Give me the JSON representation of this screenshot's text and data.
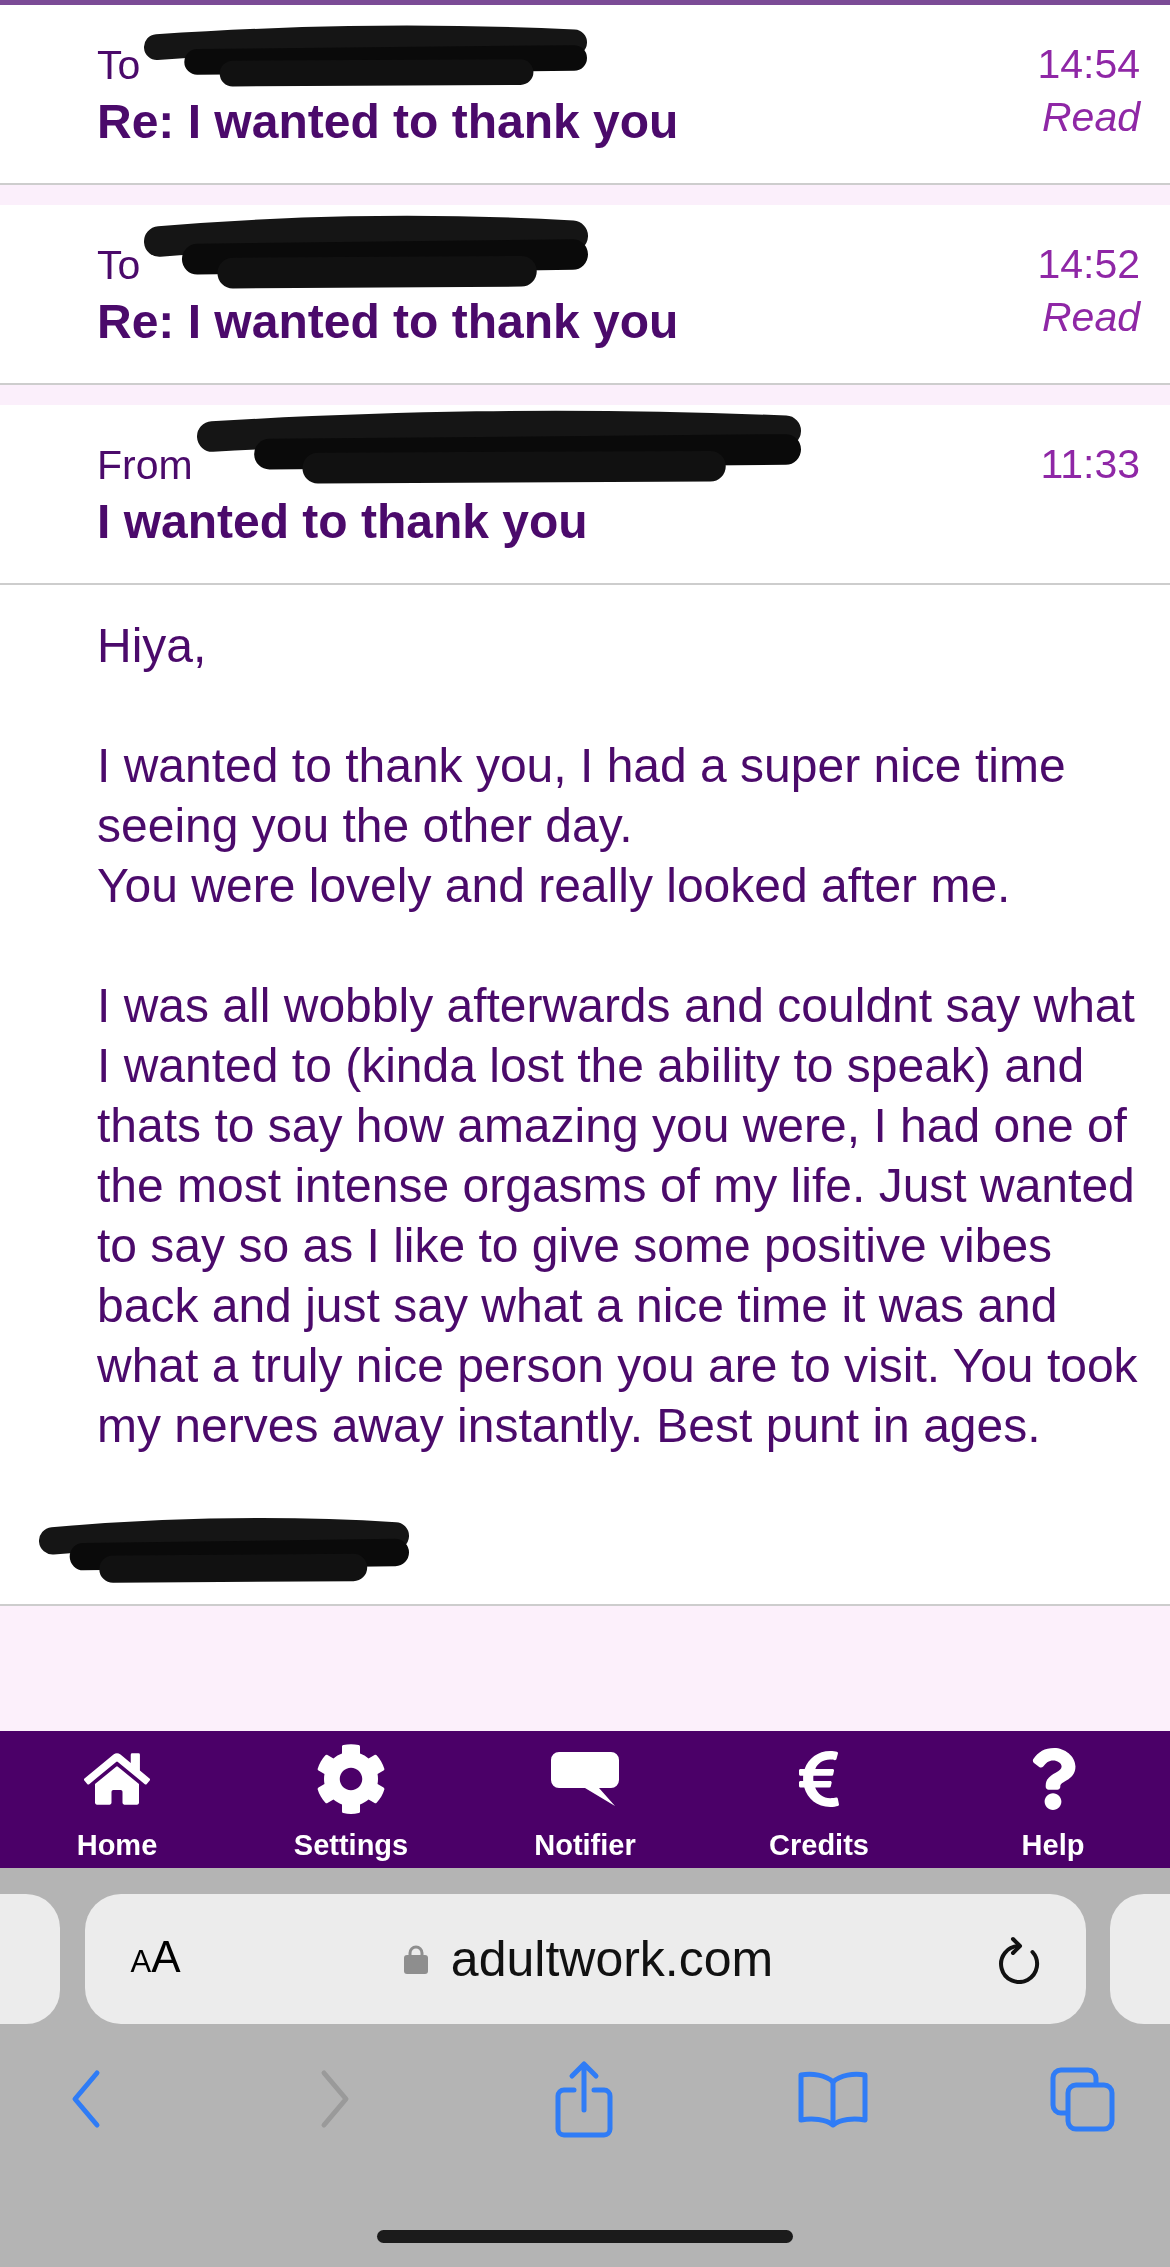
{
  "messages": [
    {
      "direction": "To",
      "sender_redacted": true,
      "subject": "Re: I wanted to thank you",
      "time": "14:54",
      "status": "Read"
    },
    {
      "direction": "To",
      "sender_redacted": true,
      "subject": "Re: I wanted to thank you",
      "time": "14:52",
      "status": "Read"
    },
    {
      "direction": "From",
      "sender_redacted": true,
      "subject": "I wanted to thank you",
      "time": "11:33"
    }
  ],
  "body": {
    "paragraphs": [
      "Hiya,",
      "I wanted to thank you, I had a super nice time seeing you the other day.\nYou were lovely and really looked after me.",
      "I was all wobbly afterwards and couldnt say what I wanted to (kinda lost the ability to speak) and thats to say how amazing you were, I had one of the most intense orgasms of my life. Just wanted to say so as I like to give some positive vibes back and just say what a nice time it was and what a truly nice person you are to visit. You took my nerves away instantly. Best punt in ages."
    ],
    "signature_redacted": true
  },
  "nav": [
    {
      "kind": "home",
      "label": "Home"
    },
    {
      "kind": "settings",
      "label": "Settings"
    },
    {
      "kind": "notifier",
      "label": "Notifier"
    },
    {
      "kind": "credits",
      "label": "Credits"
    },
    {
      "kind": "help",
      "label": "Help"
    }
  ],
  "browser": {
    "text_size": "AA",
    "url": "adultwork.com",
    "toolbar": [
      {
        "kind": "back",
        "disabled": false
      },
      {
        "kind": "forward",
        "disabled": true
      },
      {
        "kind": "share",
        "disabled": false
      },
      {
        "kind": "bookmarks",
        "disabled": false
      },
      {
        "kind": "tabs",
        "disabled": false
      }
    ]
  }
}
